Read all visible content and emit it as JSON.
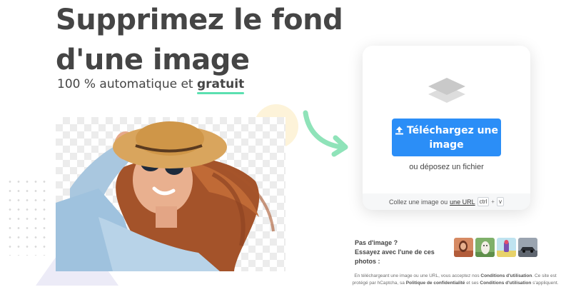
{
  "hero": {
    "title_line1": "Supprimez le fond",
    "title_line2": "d'une image",
    "subtitle_prefix": "100 % automatique et",
    "subtitle_highlight": "gratuit"
  },
  "upload": {
    "button_label": "Téléchargez une image",
    "drop_text": "ou déposez un fichier",
    "paste_text": "Collez une image ou",
    "url_link": "une URL",
    "key_ctrl": "ctrl",
    "key_plus": "+",
    "key_v": "v"
  },
  "samples": {
    "line1": "Pas d'image ?",
    "line2": "Essayez avec l'une de ces",
    "line3": "photos :",
    "thumbnails": [
      "woman-sample",
      "llama-sample",
      "product-sample",
      "car-sample"
    ]
  },
  "legal": {
    "text1": "En téléchargeant une image ou une URL, vous acceptez nos",
    "terms": "Conditions d'utilisation",
    "text2": ". Ce site est protégé par hCaptcha, sa",
    "privacy": "Politique de confidentialité",
    "text3": "et ses",
    "terms2": "Conditions d'utilisation",
    "text4": "s'appliquent."
  },
  "colors": {
    "accent_green": "#5be0b0",
    "button_blue": "#2b8ef7",
    "title_gray": "#454545"
  }
}
